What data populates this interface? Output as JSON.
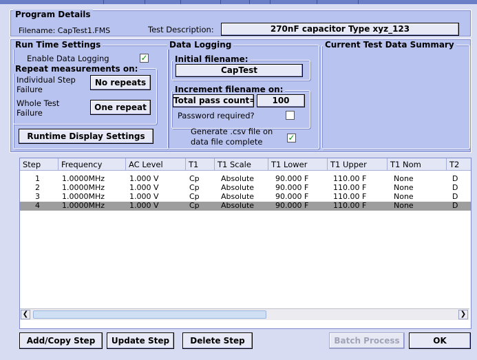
{
  "program_details": {
    "title": "Program Details",
    "filename_label": "Filename: CapTest1.FMS",
    "test_description_label": "Test Description:",
    "test_description_value": "270nF capacitor Type xyz_123"
  },
  "run_time": {
    "title": "Run Time Settings",
    "enable_logging_label": "Enable Data Logging",
    "enable_logging_checked": true,
    "repeat_title": "Repeat measurements on:",
    "individual_label_1": "Individual Step",
    "individual_label_2": "Failure",
    "individual_button": "No repeats",
    "whole_label_1": "Whole Test",
    "whole_label_2": "Failure",
    "whole_button": "One repeat",
    "runtime_display_button": "Runtime Display Settings"
  },
  "data_logging": {
    "title": "Data Logging",
    "initial_filename_title": "Initial filename:",
    "initial_filename_button": "CapTest",
    "increment_title": "Increment filename on:",
    "total_pass_button": "Total pass count=",
    "total_pass_value": "100",
    "password_label": "Password required?",
    "password_checked": false,
    "csv_label_1": "Generate .csv file on",
    "csv_label_2": "data file complete",
    "csv_checked": true
  },
  "summary": {
    "title": "Current Test Data Summary"
  },
  "table": {
    "columns": [
      "Step",
      "Frequency",
      "AC Level",
      "T1",
      "T1 Scale",
      "T1 Lower",
      "T1 Upper",
      "T1 Nom",
      "T2"
    ],
    "rows": [
      {
        "step": "1",
        "freq": "1.0000MHz",
        "ac": "1.000 V",
        "t1": "Cp",
        "scale": "Absolute",
        "lower": "90.000 F",
        "upper": "110.00 F",
        "nom": "None",
        "t2": "D",
        "selected": false
      },
      {
        "step": "2",
        "freq": "1.0000MHz",
        "ac": "1.000 V",
        "t1": "Cp",
        "scale": "Absolute",
        "lower": "90.000 F",
        "upper": "110.00 F",
        "nom": "None",
        "t2": "D",
        "selected": false
      },
      {
        "step": "3",
        "freq": "1.0000MHz",
        "ac": "1.000 V",
        "t1": "Cp",
        "scale": "Absolute",
        "lower": "90.000 F",
        "upper": "110.00 F",
        "nom": "None",
        "t2": "D",
        "selected": false
      },
      {
        "step": "4",
        "freq": "1.0000MHz",
        "ac": "1.000 V",
        "t1": "Cp",
        "scale": "Absolute",
        "lower": "90.000 F",
        "upper": "110.00 F",
        "nom": "None",
        "t2": "D",
        "selected": true
      }
    ],
    "scroll_left_icon": "chevron-left-icon",
    "scroll_right_icon": "chevron-right-icon"
  },
  "buttons": {
    "add_copy": "Add/Copy Step",
    "update": "Update Step",
    "delete": "Delete Step",
    "batch": "Batch Process",
    "ok": "OK"
  },
  "colors": {
    "background": "#d7dcf3",
    "panel": "#b9c3f0",
    "selected_row": "#9e9e9e",
    "check": "#009000"
  }
}
